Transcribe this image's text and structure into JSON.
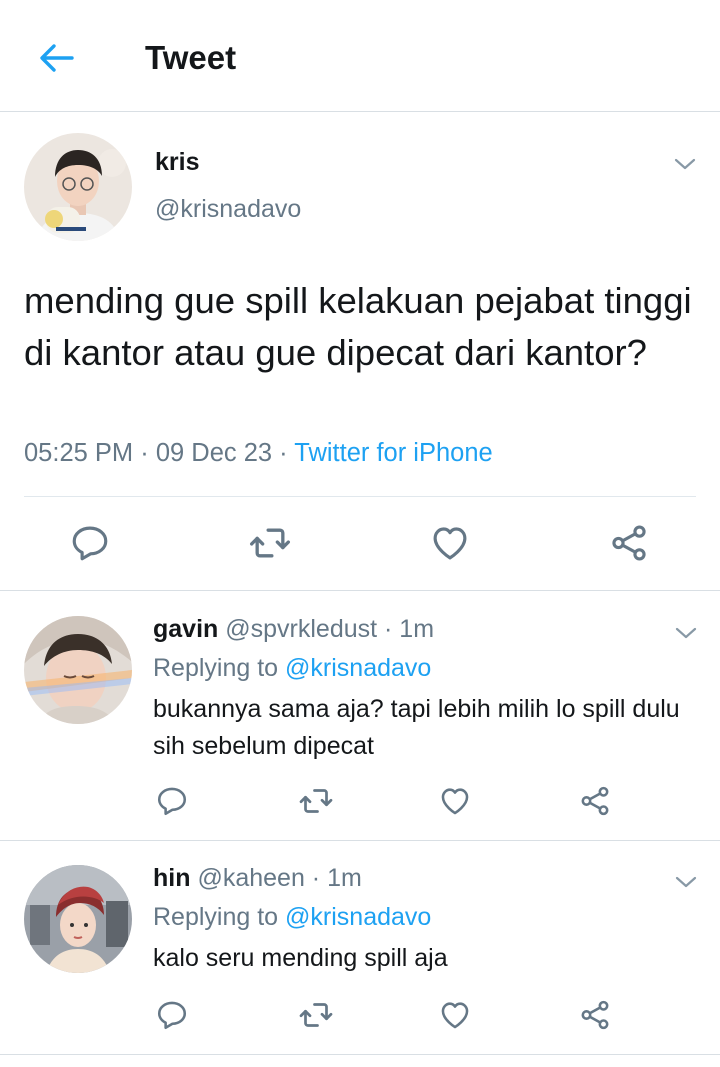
{
  "header": {
    "title": "Tweet",
    "back_icon": "arrow-left-icon",
    "accent_color": "#1da1f2"
  },
  "tweet": {
    "author_name": "kris",
    "author_handle": "@krisnadavo",
    "text": "mending gue spill kelakuan pejabat tinggi di kantor atau gue dipecat dari kantor?",
    "time": "05:25 PM",
    "sep1": " · ",
    "date": "09 Dec 23",
    "sep2": " · ",
    "source": "Twitter for iPhone",
    "actions": [
      "reply-icon",
      "retweet-icon",
      "like-icon",
      "share-icon"
    ]
  },
  "replies": [
    {
      "name": "gavin",
      "handle": "@spvrkledust",
      "dot": " · ",
      "time": "1m",
      "replying_prefix": "Replying to ",
      "replying_to": "@krisnadavo",
      "text": "bukannya sama aja? tapi lebih milih lo spill dulu sih sebelum dipecat"
    },
    {
      "name": "hin",
      "handle": "@kaheen",
      "dot": " · ",
      "time": "1m",
      "replying_prefix": "Replying to ",
      "replying_to": "@krisnadavo",
      "text": "kalo seru mending spill aja"
    }
  ],
  "colors": {
    "text": "#14171a",
    "secondary": "#657786",
    "link": "#1da1f2",
    "divider": "#d9dfe4"
  }
}
